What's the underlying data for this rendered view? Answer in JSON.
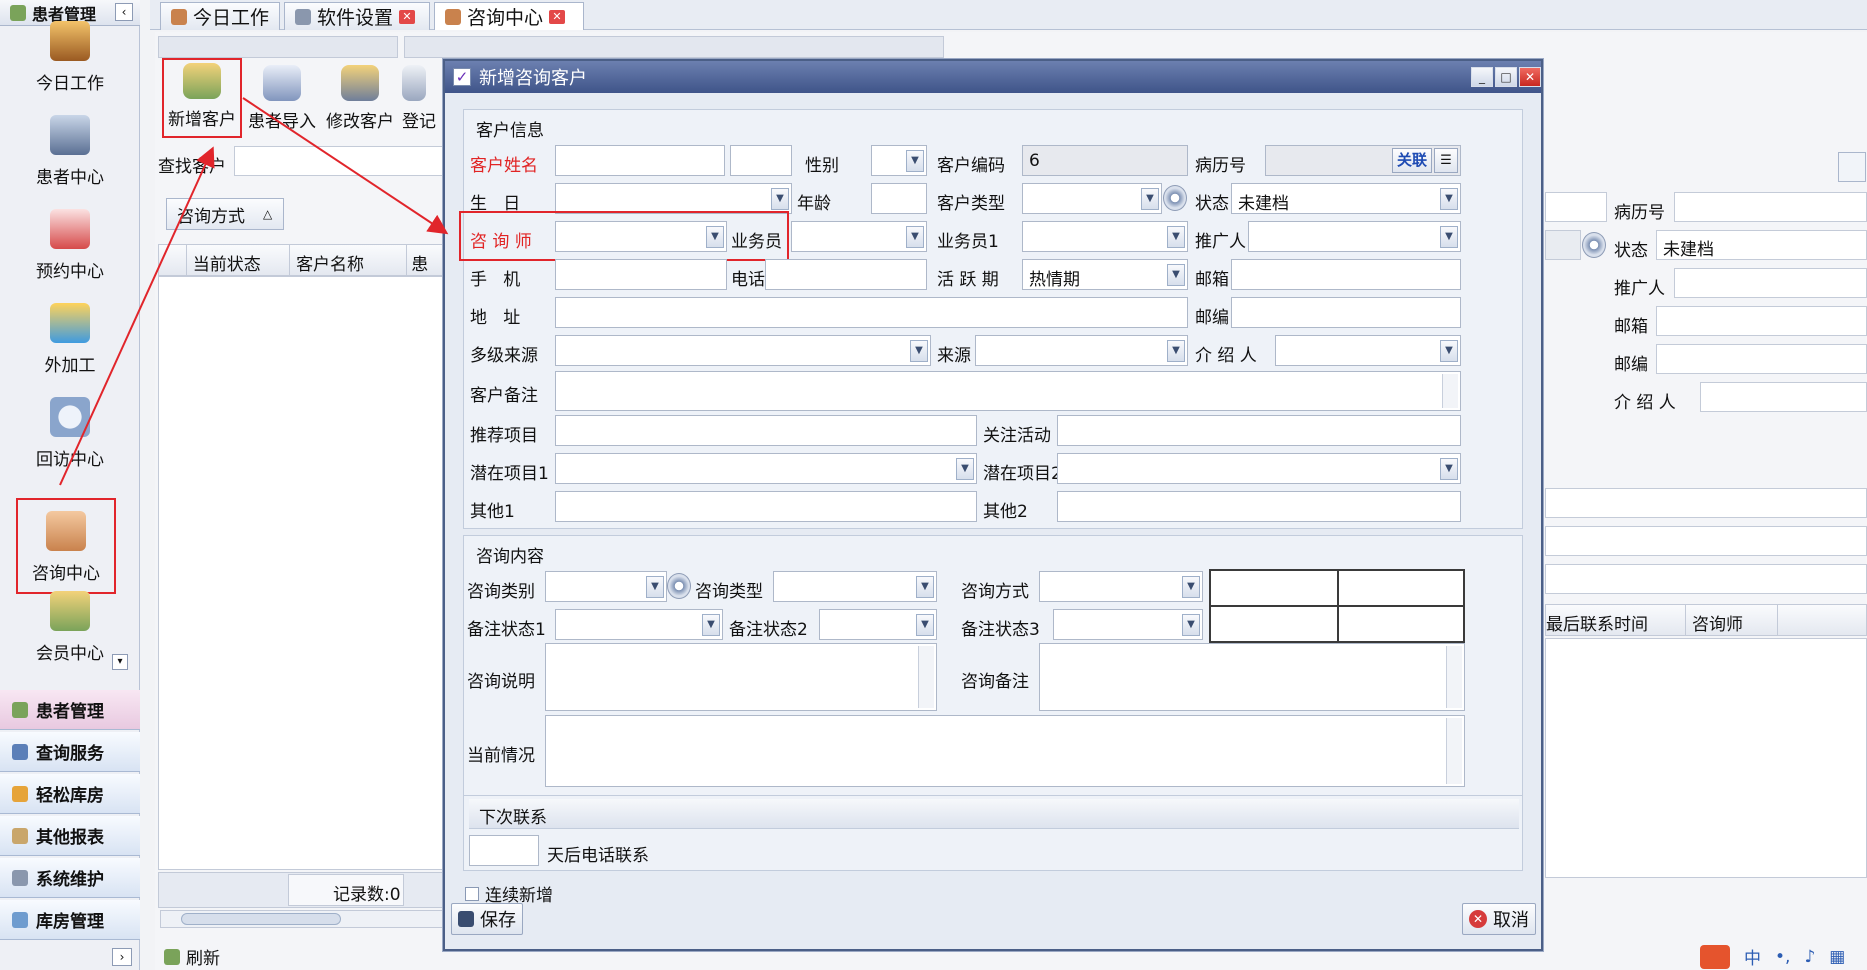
{
  "sidebar": {
    "header": "患者管理",
    "nav": [
      "今日工作",
      "患者中心",
      "预约中心",
      "外加工",
      "回访中心",
      "咨询中心",
      "会员中心"
    ],
    "groups": [
      "患者管理",
      "查询服务",
      "轻松库房",
      "其他报表",
      "系统维护",
      "库房管理"
    ]
  },
  "tabs": [
    "今日工作",
    "软件设置",
    "咨询中心"
  ],
  "toolbar": {
    "add": "新增客户",
    "import": "患者导入",
    "edit": "修改客户",
    "reg": "登记"
  },
  "background": {
    "search_label": "查找客户",
    "consult_method": "咨询方式",
    "cols": [
      "当前状态",
      "客户名称",
      "患者"
    ],
    "records": "记录数:0",
    "refresh": "刷新",
    "right_labels": {
      "record_no": "病历号",
      "status": "状态",
      "status_val": "未建档",
      "promoter": "推广人",
      "email": "邮箱",
      "zip": "邮编",
      "introducer": "介 绍 人",
      "last_contact": "最后联系时间",
      "consultant": "咨询师"
    }
  },
  "dialog": {
    "title": "新增咨询客户",
    "sec_customer": "客户信息",
    "labels": {
      "name": "客户姓名",
      "gender": "性别",
      "code": "客户编码",
      "record_no": "病历号",
      "link": "关联",
      "birthday": "生   日",
      "age": "年龄",
      "cust_type": "客户类型",
      "status": "状态",
      "consultant": "咨 询 师",
      "salesman": "业务员",
      "salesman1": "业务员1",
      "promoter": "推广人",
      "phone_mobile": "手   机",
      "phone": "电话",
      "active_period": "活 跃 期",
      "email": "邮箱",
      "address": "地   址",
      "zip": "邮编",
      "multi_source": "多级来源",
      "source": "来源",
      "introducer": "介 绍 人",
      "remark": "客户备注",
      "rec_item": "推荐项目",
      "focus": "关注活动",
      "latent1": "潜在项目1",
      "latent2": "潜在项目2",
      "other1": "其他1",
      "other2": "其他2"
    },
    "values": {
      "code": "6",
      "status": "未建档",
      "active_period": "热情期"
    },
    "sec_consult": "咨询内容",
    "consult_labels": {
      "category": "咨询类别",
      "type": "咨询类型",
      "method": "咨询方式",
      "note1": "备注状态1",
      "note2": "备注状态2",
      "note3": "备注状态3",
      "desc": "咨询说明",
      "remark": "咨询备注",
      "current": "当前情况"
    },
    "sec_next": "下次联系",
    "next_suffix": "天后电话联系",
    "continue": "连续新增",
    "save": "保存",
    "cancel": "取消"
  },
  "tray": {
    "ime": "中"
  },
  "colors": {
    "highlight": "#e1252b",
    "title_bar": "#3f5489"
  }
}
